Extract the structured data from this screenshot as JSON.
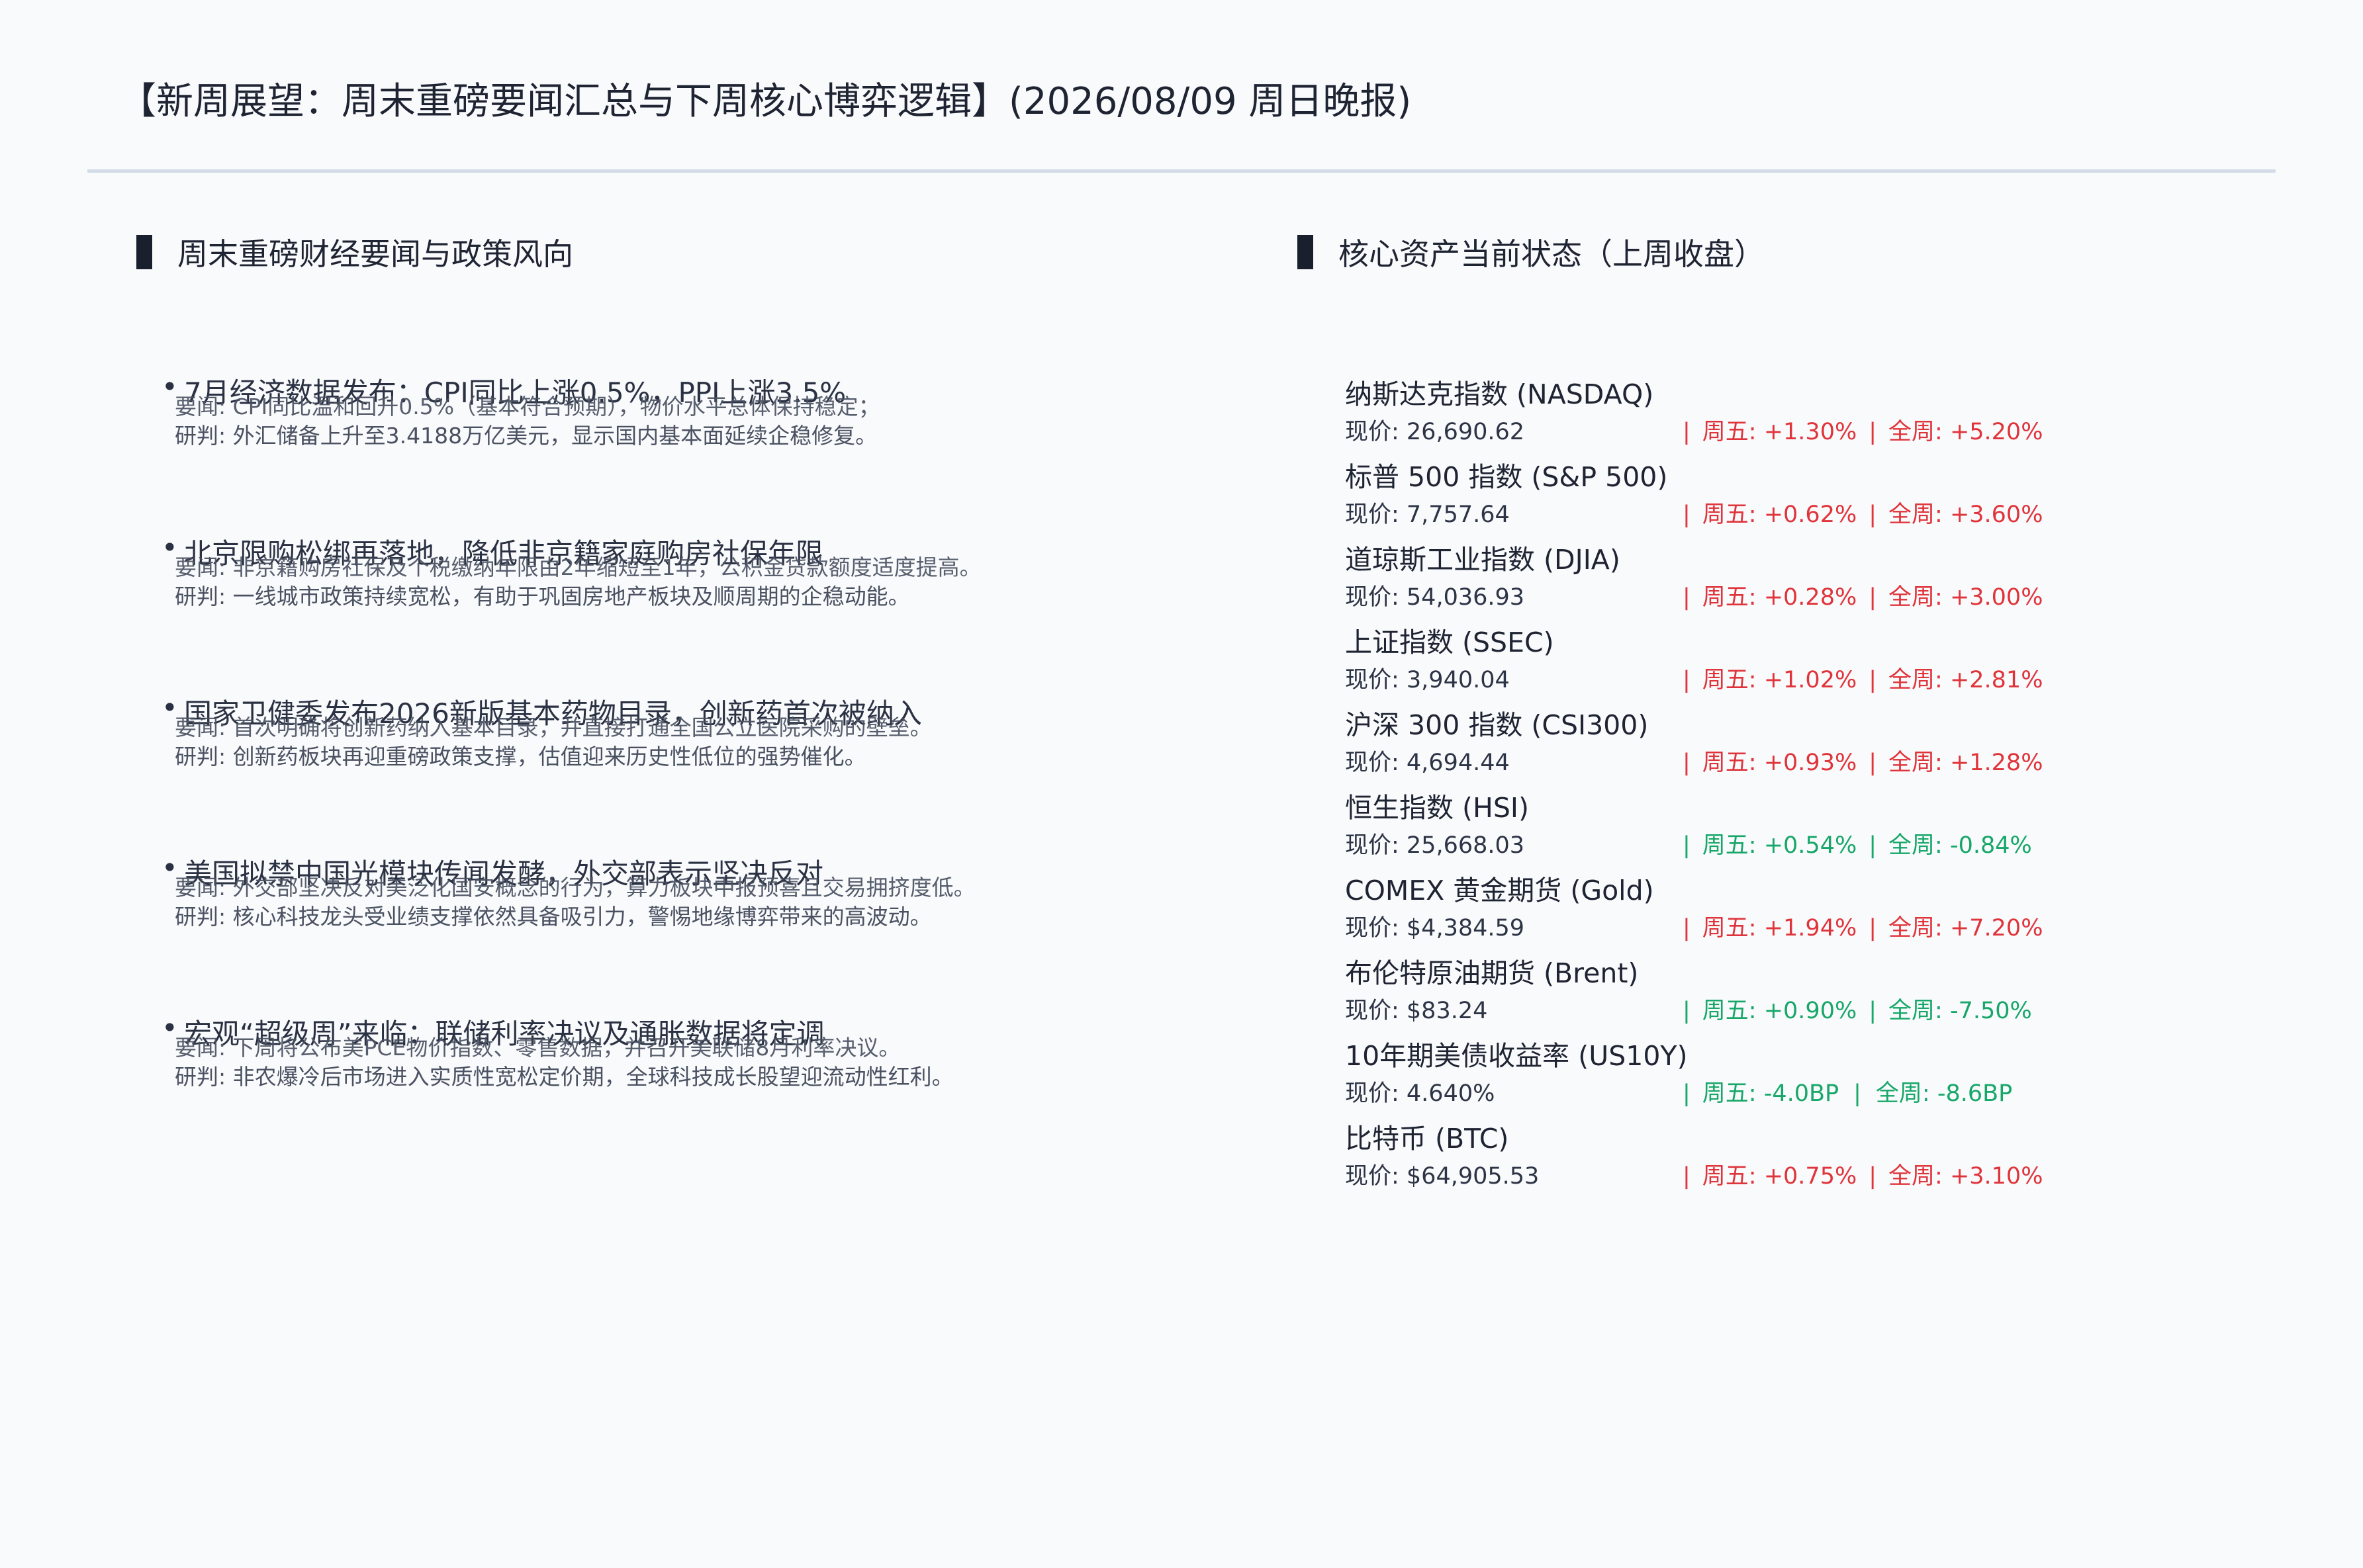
{
  "title": "【新周展望：周末重磅要闻汇总与下周核心博弈逻辑】(2026/08/09 周日晚报)",
  "sections": {
    "news_title": "周末重磅财经要闻与政策风向",
    "assets_title": "核心资产当前状态（上周收盘）"
  },
  "news": [
    {
      "headline": "7月经济数据发布：CPI同比上涨0.5%，PPI上涨3.5%",
      "line1": "要闻: CPI同比温和回升0.5%（基本符合预期），物价水平总体保持稳定；",
      "line2": "研判: 外汇储备上升至3.4188万亿美元，显示国内基本面延续企稳修复。"
    },
    {
      "headline": "北京限购松绑再落地，降低非京籍家庭购房社保年限",
      "line1": "要闻: 非京籍购房社保及个税缴纳年限由2年缩短至1年，公积金贷款额度适度提高。",
      "line2": "研判: 一线城市政策持续宽松，有助于巩固房地产板块及顺周期的企稳动能。"
    },
    {
      "headline": "国家卫健委发布2026新版基本药物目录，创新药首次被纳入",
      "line1": "要闻: 首次明确将创新药纳入基本目录，并直接打通全国公立医院采购的壁垒。",
      "line2": "研判: 创新药板块再迎重磅政策支撑，估值迎来历史性低位的强势催化。"
    },
    {
      "headline": "美国拟禁中国光模块传闻发酵，外交部表示坚决反对",
      "line1": "要闻: 外交部坚决反对美泛化国安概念的行为，算力板块中报预喜且交易拥挤度低。",
      "line2": "研判: 核心科技龙头受业绩支撑依然具备吸引力，警惕地缘博弈带来的高波动。"
    },
    {
      "headline": "宏观“超级周”来临：联储利率决议及通胀数据将定调",
      "line1": "要闻: 下周将公布美PCE物价指数、零售数据，并召开美联储8月利率决议。",
      "line2": "研判: 非农爆冷后市场进入实质性宽松定价期，全球科技成长股望迎流动性红利。"
    }
  ],
  "assets": [
    {
      "name": "纳斯达克指数 (NASDAQ)",
      "price": "现价: 26,690.62",
      "fri": "周五: +1.30%",
      "week": "全周: +5.20%",
      "dir": "up"
    },
    {
      "name": "标普 500 指数 (S&P 500)",
      "price": "现价: 7,757.64",
      "fri": "周五: +0.62%",
      "week": "全周: +3.60%",
      "dir": "up"
    },
    {
      "name": "道琼斯工业指数 (DJIA)",
      "price": "现价: 54,036.93",
      "fri": "周五: +0.28%",
      "week": "全周: +3.00%",
      "dir": "up"
    },
    {
      "name": "上证指数 (SSEC)",
      "price": "现价: 3,940.04",
      "fri": "周五: +1.02%",
      "week": "全周: +2.81%",
      "dir": "up"
    },
    {
      "name": "沪深 300 指数 (CSI300)",
      "price": "现价: 4,694.44",
      "fri": "周五: +0.93%",
      "week": "全周: +1.28%",
      "dir": "up"
    },
    {
      "name": "恒生指数 (HSI)",
      "price": "现价: 25,668.03",
      "fri": "周五: +0.54%",
      "week": "全周: -0.84%",
      "dir": "down"
    },
    {
      "name": "COMEX 黄金期货 (Gold)",
      "price": "现价: $4,384.59",
      "fri": "周五: +1.94%",
      "week": "全周: +7.20%",
      "dir": "up"
    },
    {
      "name": "布伦特原油期货 (Brent)",
      "price": "现价: $83.24",
      "fri": "周五: +0.90%",
      "week": "全周: -7.50%",
      "dir": "down"
    },
    {
      "name": "10年期美债收益率 (US10Y)",
      "price": "现价: 4.640%",
      "fri": "周五: -4.0BP",
      "week": "全周: -8.6BP",
      "dir": "down"
    },
    {
      "name": "比特币 (BTC)",
      "price": "现价: $64,905.53",
      "fri": "周五: +0.75%",
      "week": "全周: +3.10%",
      "dir": "up"
    }
  ],
  "colors": {
    "up": "#e0343b",
    "down": "#17a769"
  }
}
